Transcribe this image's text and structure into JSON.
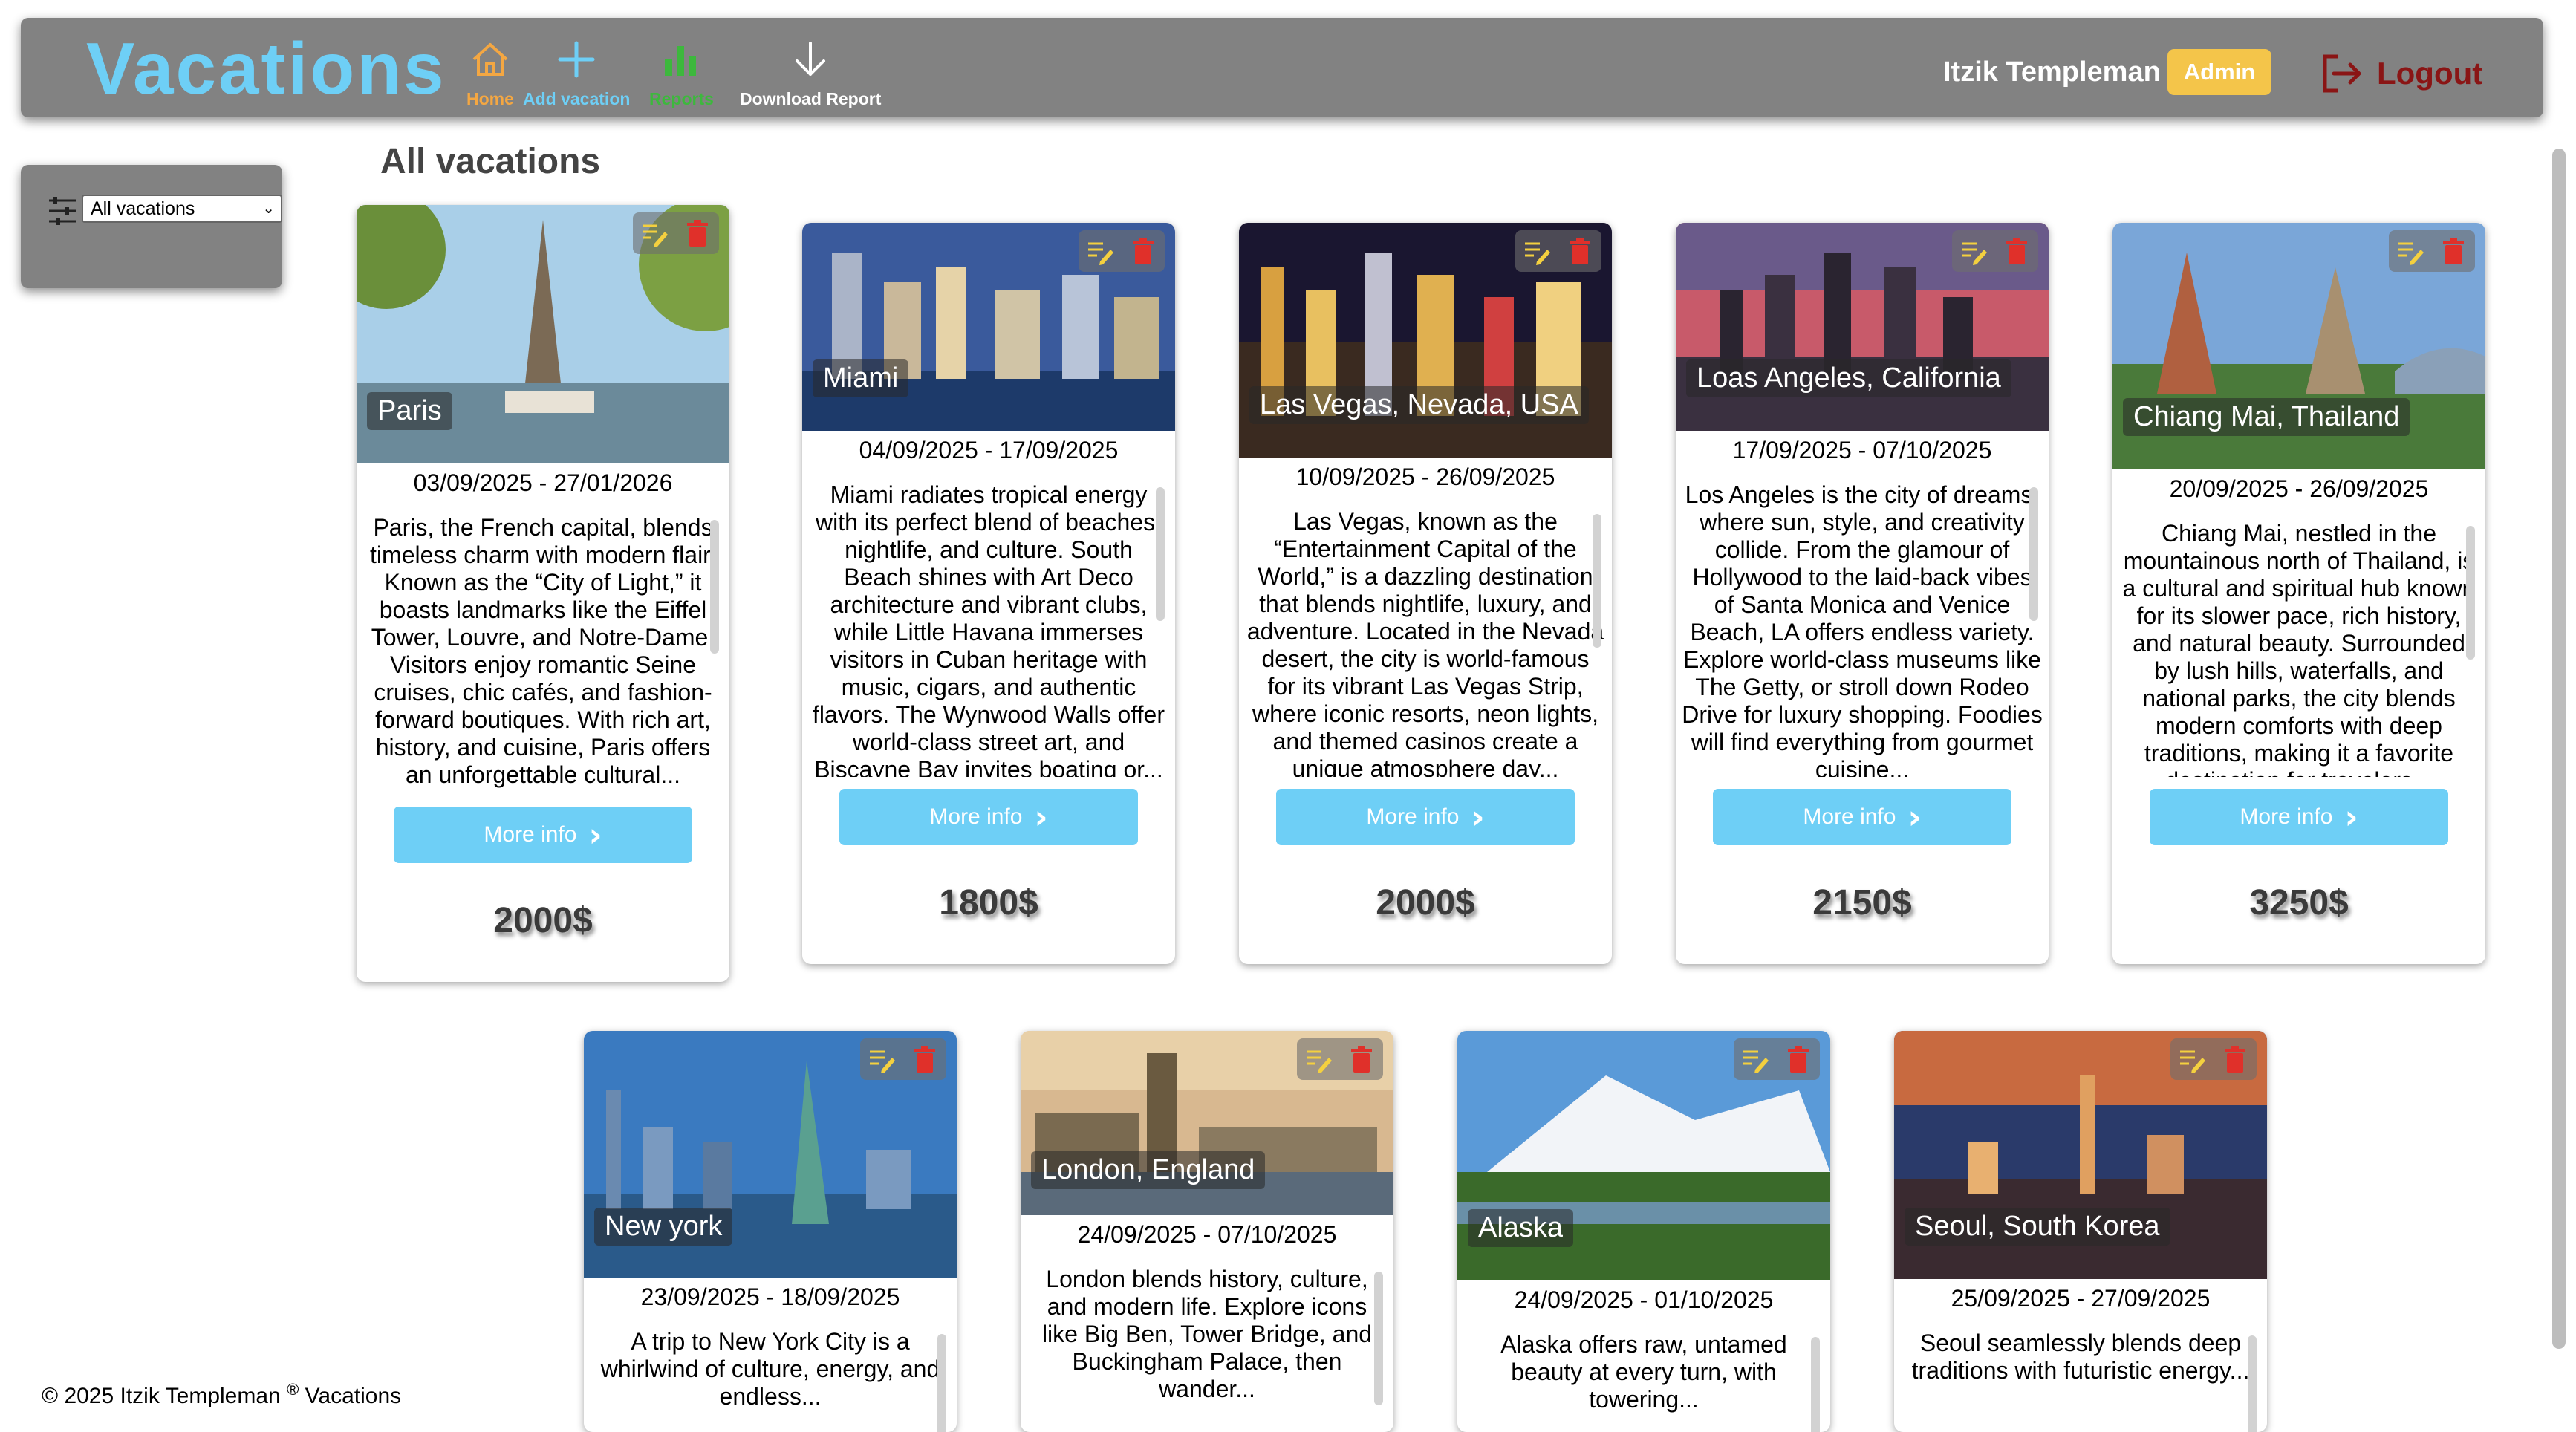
{
  "app": {
    "brand": "Vacations",
    "nav": [
      {
        "label": "Home",
        "icon": "home-icon"
      },
      {
        "label": "Add vacation",
        "icon": "plus-icon"
      },
      {
        "label": "Reports",
        "icon": "bar-chart-icon"
      },
      {
        "label": "Download Report",
        "icon": "download-icon"
      }
    ],
    "user_name": "Itzik Templeman",
    "role_badge": "Admin",
    "logout_label": "Logout",
    "colors": {
      "accent": "#6ecff6",
      "home": "#f4a742",
      "reports": "#3db83d",
      "logout": "#8a1515",
      "admin": "#f4c54a",
      "bar": "#828282"
    }
  },
  "filter": {
    "selected": "All vacations",
    "icon": "filter-sliders-icon"
  },
  "page_title": "All vacations",
  "more_info_label": "More info",
  "vacations": [
    {
      "title": "Paris",
      "dates": "03/09/2025 - 27/01/2026",
      "price": "2000$",
      "description": "Paris, the French capital, blends timeless charm with modern flair. Known as the “City of Light,” it boasts landmarks like the Eiffel Tower, Louvre, and Notre-Dame. Visitors enjoy romantic Seine cruises, chic cafés, and fashion-forward boutiques. With rich art, history, and cuisine, Paris offers an unforgettable cultural..."
    },
    {
      "title": "Miami",
      "dates": "04/09/2025 - 17/09/2025",
      "price": "1800$",
      "description": "Miami radiates tropical energy with its perfect blend of beaches, nightlife, and culture. South Beach shines with Art Deco architecture and vibrant clubs, while Little Havana immerses visitors in Cuban heritage with music, cigars, and authentic flavors. The Wynwood Walls offer world-class street art, and Biscayne Bay invites boating or..."
    },
    {
      "title": "Las Vegas, Nevada, USA",
      "dates": "10/09/2025 - 26/09/2025",
      "price": "2000$",
      "description": "Las Vegas, known as the “Entertainment Capital of the World,” is a dazzling destination that blends nightlife, luxury, and adventure. Located in the Nevada desert, the city is world-famous for its vibrant Las Vegas Strip, where iconic resorts, neon lights, and themed casinos create a unique atmosphere day..."
    },
    {
      "title": "Loas Angeles, California",
      "dates": "17/09/2025 - 07/10/2025",
      "price": "2150$",
      "description": "Los Angeles is the city of dreams, where sun, style, and creativity collide. From the glamour of Hollywood to the laid-back vibes of Santa Monica and Venice Beach, LA offers endless variety. Explore world-class museums like The Getty, or stroll down Rodeo Drive for luxury shopping. Foodies will find everything from gourmet cuisine..."
    },
    {
      "title": "Chiang Mai, Thailand",
      "dates": "20/09/2025 - 26/09/2025",
      "price": "3250$",
      "description": "Chiang Mai, nestled in the mountainous north of Thailand, is a cultural and spiritual hub known for its slower pace, rich history, and natural beauty. Surrounded by lush hills, waterfalls, and national parks, the city blends modern comforts with deep traditions, making it a favorite destination for travelers..."
    },
    {
      "title": "New york",
      "dates": "23/09/2025 - 18/09/2025",
      "price": "",
      "description": "A trip to New York City is a whirlwind of culture, energy, and endless..."
    },
    {
      "title": "London, England",
      "dates": "24/09/2025 - 07/10/2025",
      "price": "",
      "description": "London blends history, culture, and modern life. Explore icons like Big Ben, Tower Bridge, and Buckingham Palace, then wander..."
    },
    {
      "title": "Alaska",
      "dates": "24/09/2025 - 01/10/2025",
      "price": "",
      "description": "Alaska offers raw, untamed beauty at every turn, with towering..."
    },
    {
      "title": "Seoul, South Korea",
      "dates": "25/09/2025 - 27/09/2025",
      "price": "",
      "description": "Seoul seamlessly blends deep traditions with futuristic energy..."
    }
  ],
  "footer": {
    "text": "© 2025 Itzik Templeman",
    "mark": "®",
    "suffix": " Vacations"
  }
}
